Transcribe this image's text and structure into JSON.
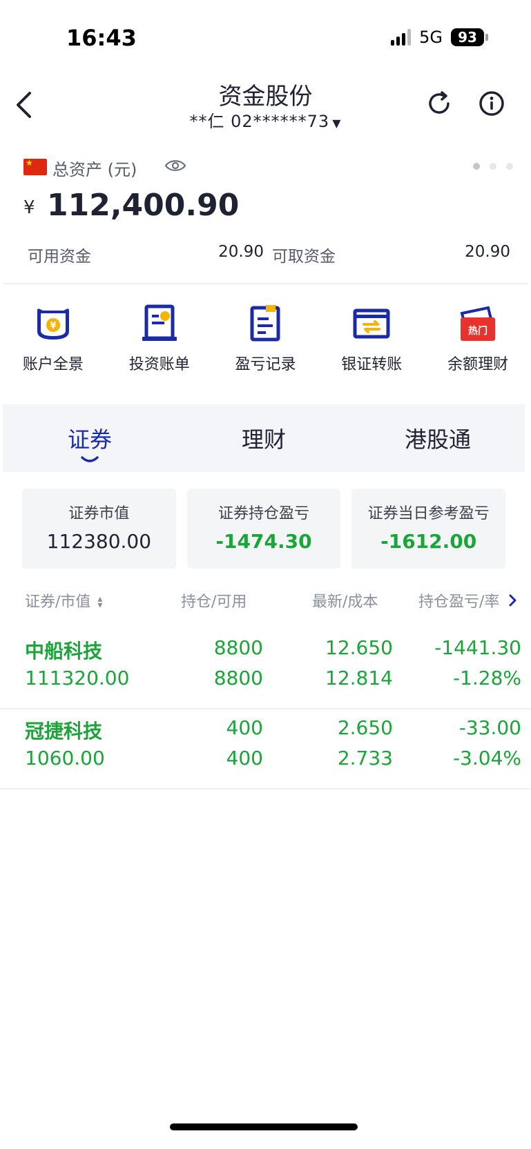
{
  "status_bar": {
    "time": "16:43",
    "network": "5G",
    "battery": "93"
  },
  "header": {
    "title": "资金股份",
    "account": "**仁 02******73"
  },
  "assets": {
    "label": "总资产 (元)",
    "currency_symbol": "¥",
    "total": "112,400.90",
    "available_label": "可用资金",
    "available_value": "20.90",
    "withdrawable_label": "可取资金",
    "withdrawable_value": "20.90",
    "page_indicator": {
      "count": 3,
      "active": 0
    }
  },
  "actions": [
    {
      "label": "账户全景",
      "icon": "account-overview-icon"
    },
    {
      "label": "投资账单",
      "icon": "investment-bill-icon"
    },
    {
      "label": "盈亏记录",
      "icon": "profit-loss-record-icon"
    },
    {
      "label": "银证转账",
      "icon": "bank-transfer-icon"
    },
    {
      "label": "余额理财",
      "icon": "balance-wealth-icon",
      "badge": "热门"
    }
  ],
  "tabs": [
    {
      "label": "证券",
      "active": true
    },
    {
      "label": "理财",
      "active": false
    },
    {
      "label": "港股通",
      "active": false
    }
  ],
  "summary": [
    {
      "label": "证券市值",
      "value": "112380.00"
    },
    {
      "label": "证券持仓盈亏",
      "value": "-1474.30"
    },
    {
      "label": "证券当日参考盈亏",
      "value": "-1612.00"
    }
  ],
  "table": {
    "headers": {
      "security": "证券/市值",
      "position": "持仓/可用",
      "latest": "最新/成本",
      "pnl": "持仓盈亏/率"
    },
    "rows": [
      {
        "name": "中船科技",
        "market_value": "111320.00",
        "holding": "8800",
        "available": "8800",
        "latest": "12.650",
        "cost": "12.814",
        "pnl": "-1441.30",
        "pnl_rate": "-1.28%"
      },
      {
        "name": "冠捷科技",
        "market_value": "1060.00",
        "holding": "400",
        "available": "400",
        "latest": "2.650",
        "cost": "2.733",
        "pnl": "-33.00",
        "pnl_rate": "-3.04%"
      }
    ]
  },
  "colors": {
    "accent_blue": "#1b2ba8",
    "loss_green": "#19a538",
    "badge_red": "#e8322d",
    "icon_yellow": "#f4b400"
  }
}
